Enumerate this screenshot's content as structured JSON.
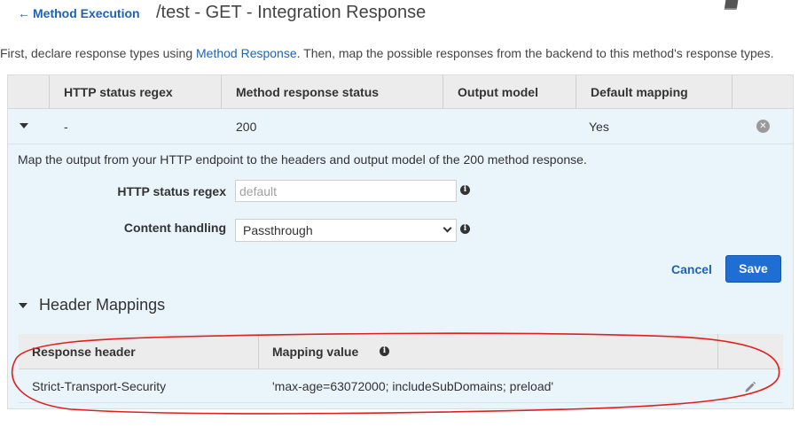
{
  "header": {
    "back_label": "Method Execution",
    "title": "/test - GET - Integration Response"
  },
  "intro": {
    "before": "First, declare response types using ",
    "link": "Method Response",
    "after": ". Then, map the possible responses from the backend to this method's response types."
  },
  "responses_table": {
    "columns": [
      "HTTP status regex",
      "Method response status",
      "Output model",
      "Default mapping"
    ],
    "rows": [
      {
        "regex": "-",
        "status": "200",
        "model": "",
        "default": "Yes"
      }
    ]
  },
  "detail": {
    "description": "Map the output from your HTTP endpoint to the headers and output model of the 200 method response.",
    "regex_label": "HTTP status regex",
    "regex_placeholder": "default",
    "regex_value": "",
    "content_label": "Content handling",
    "content_value": "Passthrough",
    "cancel_label": "Cancel",
    "save_label": "Save"
  },
  "header_mappings": {
    "title": "Header Mappings",
    "columns": [
      "Response header",
      "Mapping value"
    ],
    "rows": [
      {
        "header": "Strict-Transport-Security",
        "value": "'max-age=63072000; includeSubDomains; preload'"
      }
    ]
  },
  "colors": {
    "link": "#1f62b5",
    "primary_button": "#1f6ed4",
    "panel_bg": "#eaf4fb",
    "table_head_bg": "#ececec",
    "annotation": "#e0201e"
  },
  "icons": [
    "arrow-left-icon",
    "book-icon",
    "caret-down-icon",
    "close-circle-icon",
    "info-icon",
    "chevron-down-icon",
    "pencil-icon"
  ]
}
